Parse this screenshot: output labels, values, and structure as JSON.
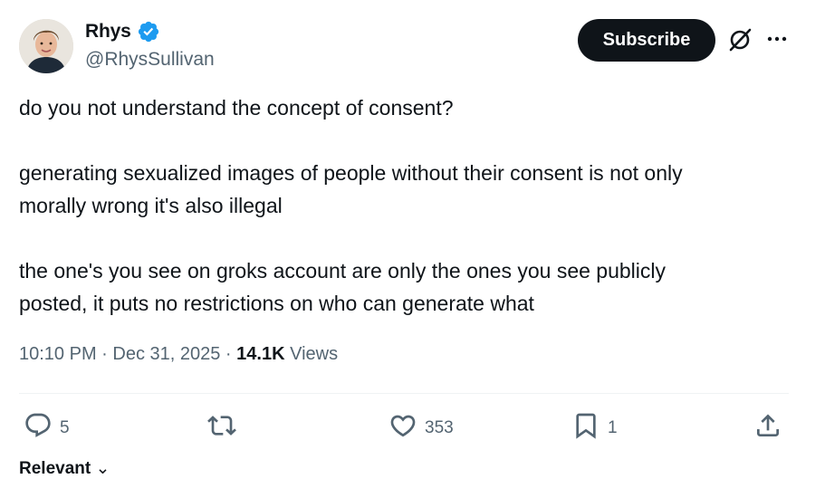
{
  "author": {
    "name": "Rhys",
    "handle": "@RhysSullivan",
    "verified_color": "#1d9bf0"
  },
  "header": {
    "subscribe_label": "Subscribe"
  },
  "tweet": {
    "line1": "do you not understand the concept of consent?",
    "line2": "generating sexualized images of people without their consent is not only",
    "line3": "morally wrong it's also illegal",
    "line4": "the one's you see on groks account are only the ones you see publicly",
    "line5": "posted, it puts no restrictions on who can generate what"
  },
  "meta": {
    "time": "10:10 PM",
    "separator": " · ",
    "date": "Dec 31, 2025",
    "views_count": "14.1K",
    "views_label": "Views"
  },
  "actions": {
    "replies": "5",
    "retweets": "",
    "likes": "353",
    "bookmarks": "1"
  },
  "footer": {
    "relevant_label": "Relevant"
  },
  "colors": {
    "text": "#0f1419",
    "secondary": "#536471",
    "accent": "#1d9bf0"
  },
  "icons": [
    "verified-badge-icon",
    "grok-icon",
    "more-icon",
    "reply-icon",
    "retweet-icon",
    "like-icon",
    "bookmark-icon",
    "share-icon",
    "chevron-down-icon"
  ]
}
